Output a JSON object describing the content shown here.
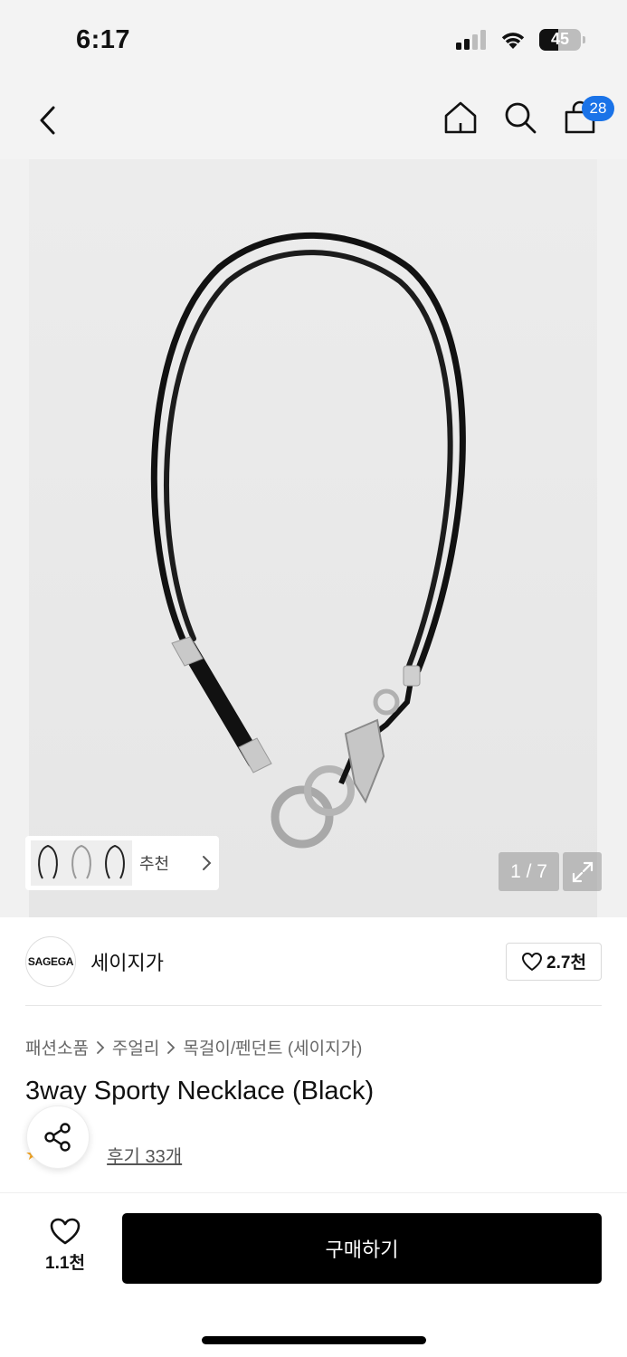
{
  "status": {
    "time": "6:17",
    "battery": "45",
    "battery_level": 0.45
  },
  "nav": {
    "cart_count": "28"
  },
  "gallery": {
    "recommend_label": "추천",
    "page_counter": "1 / 7"
  },
  "brand": {
    "logo_text": "SAGEGA",
    "name": "세이지가",
    "likes": "2.7천"
  },
  "breadcrumb": [
    "패션소품",
    "주얼리",
    "목걸이/펜던트 (세이지가)"
  ],
  "product": {
    "title": "3way Sporty Necklace (Black)",
    "reviews": "후기 33개"
  },
  "bottom": {
    "wish_count": "1.1천",
    "buy_label": "구매하기"
  },
  "colors": {
    "accent": "#1a73e8",
    "star": "#f5a623",
    "buy_bg": "#000000"
  }
}
